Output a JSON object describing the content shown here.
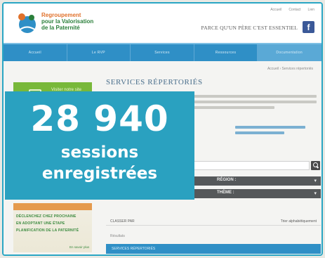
{
  "header": {
    "logo_lines": [
      "Regroupement",
      "pour la Valorisation",
      "de la Paternité"
    ],
    "top_links": [
      "Accueil",
      "Contact",
      "Lien"
    ],
    "tagline": "PARCE QU'UN PÈRE C'EST ESSENTIEL",
    "facebook_icon": "facebook-icon"
  },
  "nav": {
    "items": [
      "Accueil",
      "Le RVP",
      "Services",
      "Ressources",
      "Documentation"
    ],
    "active_index": 4
  },
  "breadcrumb": "Accueil › Services répertoriés",
  "sidebar": {
    "promo_label": "Visiter notre site",
    "promo_icon": "screen-icon",
    "banner_lines": [
      "DÉCLENCHEZ CHEZ PROCHAINE",
      "EN ADOPTANT UNE ÉTAPE",
      "PLANIFICATION DE LA PATERNITÉ"
    ],
    "banner_more": "En savoir plus"
  },
  "main": {
    "title": "SERVICES RÉPERTORIÉS",
    "dropdowns": [
      "RÉGION :",
      "THÈME :"
    ],
    "result_title": "CLASSER PAR",
    "result_sort": "Trier alphabétiquement",
    "result_sub": "Résultats",
    "result_bar": "SERVICES RÉPERTORIÉS"
  },
  "stat": {
    "number": "28 940",
    "line1": "sessions",
    "line2": "enregistrées"
  },
  "colors": {
    "accent": "#2aa1c0",
    "nav": "#2f8fc6",
    "sidebar_green": "#78b83a"
  }
}
